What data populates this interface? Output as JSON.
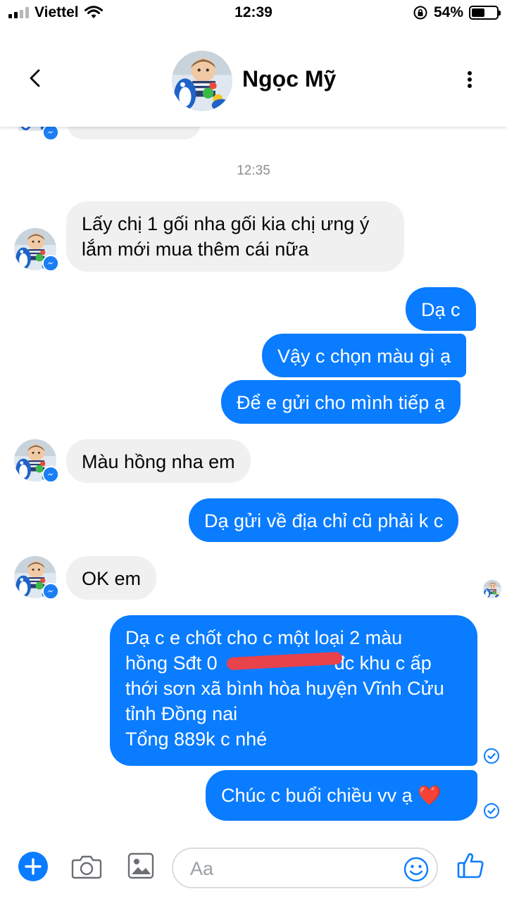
{
  "status_bar": {
    "carrier": "Viettel",
    "time": "12:39",
    "battery": "54%",
    "battery_level": 0.54
  },
  "header": {
    "contact_name": "Ngọc Mỹ"
  },
  "conversation": {
    "timestamp": "12:35",
    "incoming": [
      {
        "line1": "Lấy chị 1 gối nha gối kia chị ưng ý",
        "line2": "lắm mới mua thêm cái nữa"
      },
      {
        "text": "Màu hồng nha em"
      },
      {
        "text": "OK em"
      }
    ],
    "outgoing": [
      {
        "text": "Dạ c"
      },
      {
        "text": "Vậy c chọn màu gì ạ"
      },
      {
        "text": "Để e gửi cho mình tiếp ạ"
      },
      {
        "text": "Dạ gửi về địa chỉ cũ phải k c"
      },
      {
        "line1": "Dạ c e chốt cho c một  loại 2 màu",
        "line2_a": "hồng Sđt 0",
        "line2_b": "đc khu c ấp",
        "line3": "thới sơn xã bình hòa huyện Vĩnh Cửu",
        "line4": "tỉnh Đồng nai",
        "line5": "Tổng 889k c nhé"
      },
      {
        "text": "Chúc c buổi chiều vv ạ",
        "emoji": "❤️"
      }
    ]
  },
  "composer": {
    "placeholder": "Aa"
  },
  "icons": {
    "back": "chevron-left-icon",
    "more": "more-vertical-icon",
    "plus": "plus-icon",
    "camera": "camera-icon",
    "image": "image-icon",
    "emoji": "smile-icon",
    "like": "thumbs-up-icon",
    "messenger_badge": "messenger-icon",
    "sent": "check-circle-icon"
  },
  "colors": {
    "accent": "#0a7cff",
    "incoming_bubble": "#f0f0f0",
    "badge": "#1a7ef5"
  }
}
